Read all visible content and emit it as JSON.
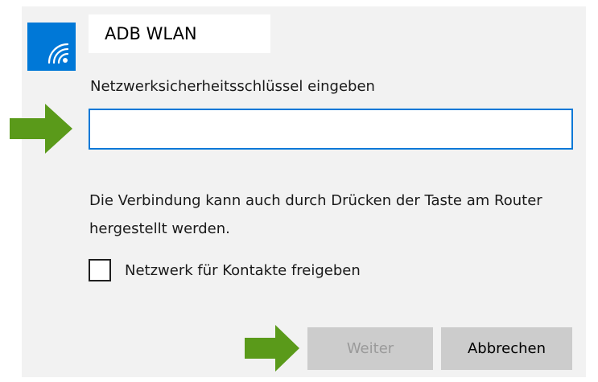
{
  "network": {
    "icon": "wifi-icon",
    "ssid": "ADB WLAN"
  },
  "key_prompt": "Netzwerksicherheitsschlüssel eingeben",
  "key_field": {
    "value": "",
    "placeholder": ""
  },
  "wps_hint": "Die Verbindung kann auch durch Drücken der Taste am Router hergestellt werden.",
  "share_checkbox": {
    "label": "Netzwerk für Kontakte freigeben",
    "checked": false
  },
  "buttons": {
    "next_label": "Weiter",
    "next_enabled": false,
    "cancel_label": "Abbrechen"
  },
  "colors": {
    "accent": "#0078d7",
    "annotation_arrow": "#5a9a1a",
    "panel_background": "#f2f2f2",
    "button_background": "#cccccc",
    "disabled_text": "#9a9a9a"
  }
}
